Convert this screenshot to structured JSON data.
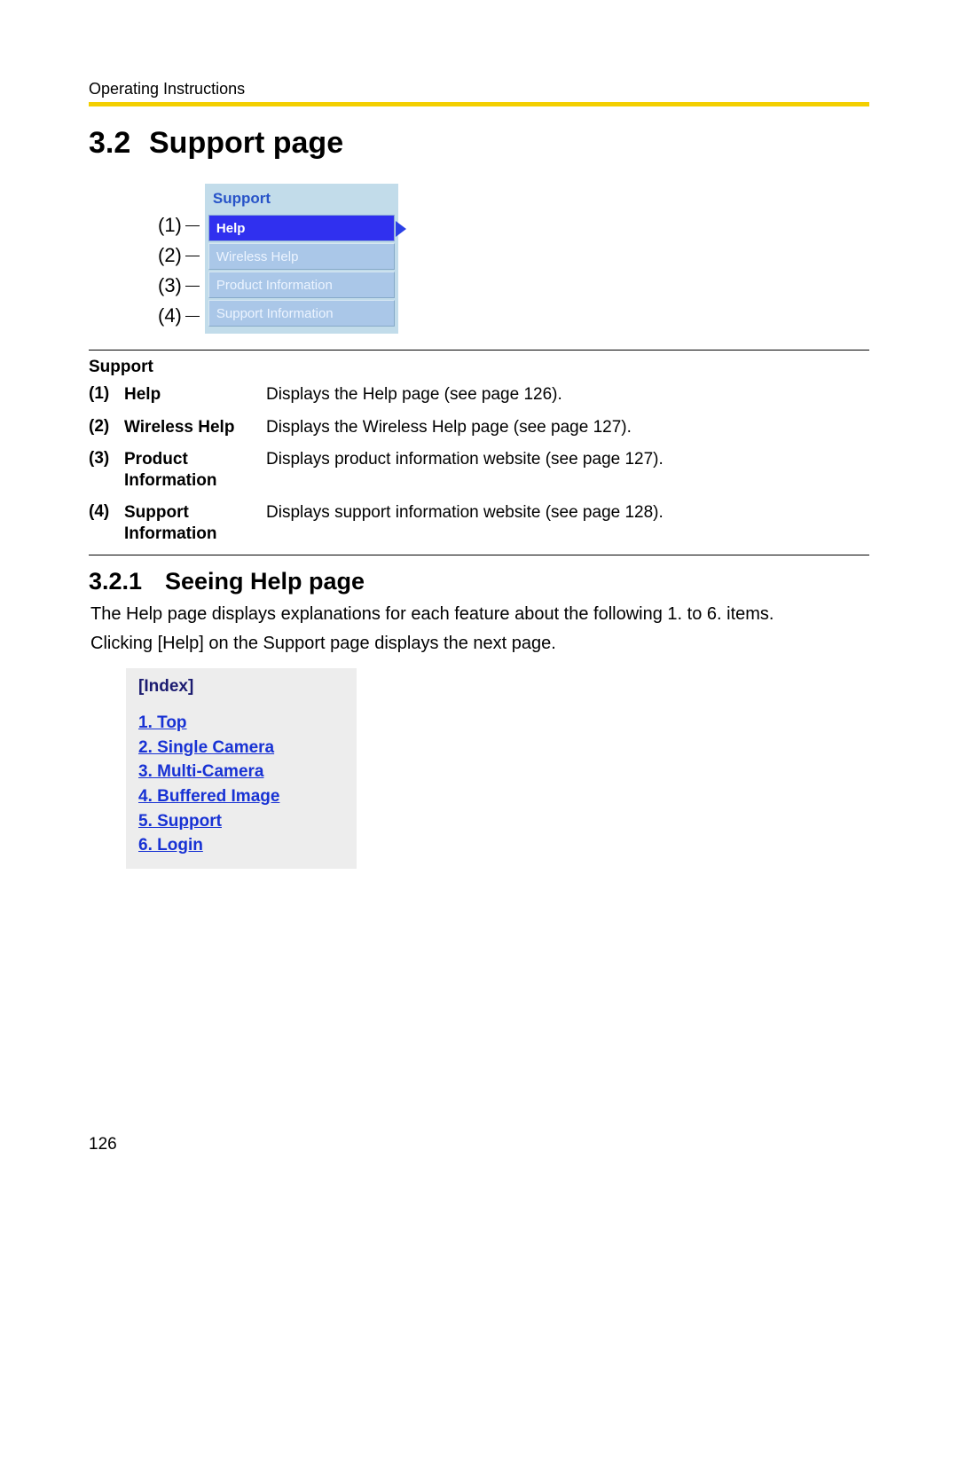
{
  "header": {
    "label": "Operating Instructions"
  },
  "section": {
    "number": "3.2",
    "title": "Support page"
  },
  "menu": {
    "title": "Support",
    "callouts": [
      "(1)",
      "(2)",
      "(3)",
      "(4)"
    ],
    "items": [
      {
        "label": "Help",
        "selected": true
      },
      {
        "label": "Wireless Help",
        "selected": false
      },
      {
        "label": "Product Information",
        "selected": false
      },
      {
        "label": "Support Information",
        "selected": false
      }
    ]
  },
  "table": {
    "title": "Support",
    "rows": [
      {
        "num": "(1)",
        "term": "Help",
        "desc": "Displays the Help page (see page 126)."
      },
      {
        "num": "(2)",
        "term": "Wireless Help",
        "desc": "Displays the Wireless Help page (see page 127)."
      },
      {
        "num": "(3)",
        "term": "Product Information",
        "desc": "Displays product information website (see page 127)."
      },
      {
        "num": "(4)",
        "term": "Support Information",
        "desc": "Displays support information website (see page 128)."
      }
    ]
  },
  "subsection": {
    "number": "3.2.1",
    "title": "Seeing Help page"
  },
  "paragraphs": [
    "The Help page displays explanations for each feature about the following 1. to 6. items.",
    "Clicking [Help] on the Support page displays the next page."
  ],
  "index_box": {
    "title": "[Index]",
    "links": [
      "1. Top",
      "2. Single Camera",
      "3. Multi-Camera",
      "4. Buffered Image",
      "5. Support",
      "6. Login"
    ]
  },
  "page_number": "126"
}
